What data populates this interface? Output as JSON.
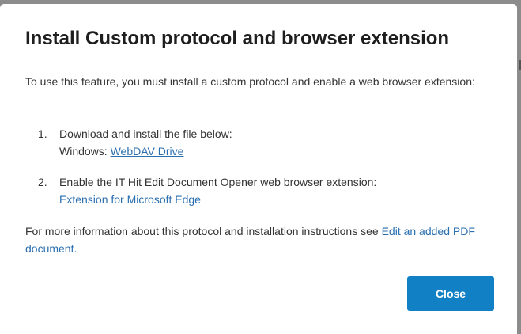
{
  "dialog": {
    "title": "Install Custom protocol and browser extension",
    "intro": "To use this feature, you must install a custom protocol and enable a web browser extension:",
    "steps": [
      {
        "number": "1.",
        "line1": "Download and install the file below:",
        "prefix": "Windows: ",
        "link": "WebDAV Drive"
      },
      {
        "number": "2.",
        "line1": "Enable the IT Hit Edit Document Opener web browser extension:",
        "link": "Extension for Microsoft Edge"
      }
    ],
    "footer_text": "For more information about this protocol and installation instructions see ",
    "footer_link": "Edit an added PDF document",
    "footer_end": ".",
    "close_label": "Close"
  },
  "colors": {
    "accent": "#1280c4",
    "link": "#2a6fb0",
    "overlay": "#8c8c8c"
  }
}
